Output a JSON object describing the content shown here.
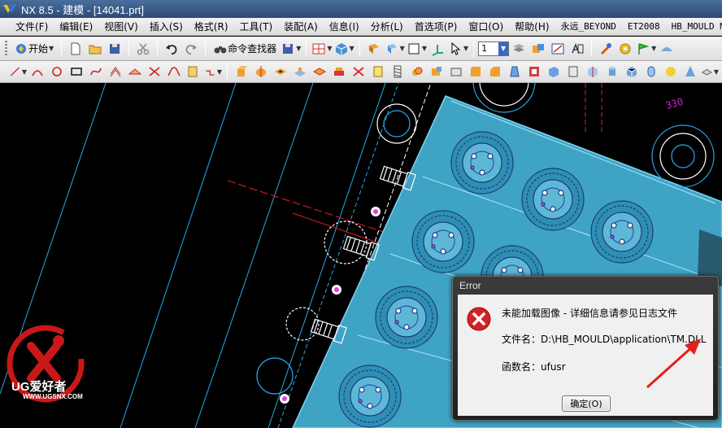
{
  "window": {
    "title": "NX 8.5 - 建模 - [14041.prt]"
  },
  "menubar": {
    "items": [
      "文件(F)",
      "编辑(E)",
      "视图(V)",
      "插入(S)",
      "格式(R)",
      "工具(T)",
      "装配(A)",
      "信息(I)",
      "分析(L)",
      "首选项(P)",
      "窗口(O)",
      "帮助(H)",
      "永远_BEYOND",
      "ET2008",
      "HB_MOULD M"
    ]
  },
  "toolbar1": {
    "start_label": "开始",
    "command_finder_label": "命令查找器",
    "layer_value": "1"
  },
  "watermark": {
    "brand": "UG爱好者",
    "url": "WWW.UGSNX.COM"
  },
  "graphics": {
    "dimension_text": "330"
  },
  "dialog": {
    "title": "Error",
    "line1": "未能加载图像 - 详细信息请参见日志文件",
    "line2": "文件名：D:\\HB_MOULD\\application\\TM.DLL",
    "line3": "函数名：ufusr",
    "ok_label": "确定(O)"
  },
  "colors": {
    "part_face": "#3fa3c4",
    "annotation_arrow": "#e0201c",
    "error_icon": "#d42222"
  }
}
